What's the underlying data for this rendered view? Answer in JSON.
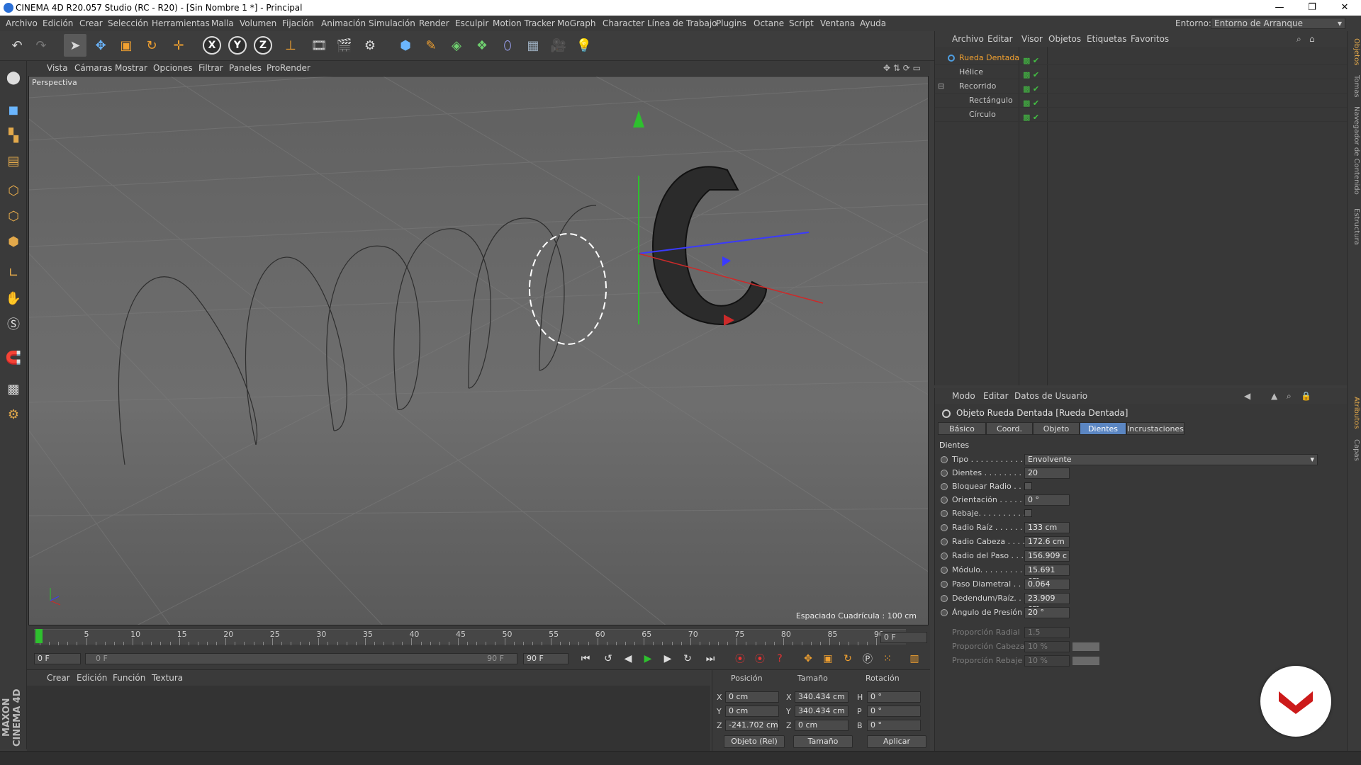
{
  "window": {
    "title": "CINEMA 4D R20.057 Studio (RC - R20) - [Sin Nombre 1 *] - Principal",
    "minimize": "—",
    "maximize": "❐",
    "close": "✕"
  },
  "menu": [
    "Archivo",
    "Edición",
    "Crear",
    "Selección",
    "Herramientas",
    "Malla",
    "Volumen",
    "Fijación",
    "Animación",
    "Simulación",
    "Render",
    "Esculpir",
    "Motion Tracker",
    "MoGraph",
    "Character",
    "Línea de Trabajo",
    "Plugins",
    "Octane",
    "Script",
    "Ventana",
    "Ayuda"
  ],
  "environment": {
    "label": "Entorno:",
    "value": "Entorno de Arranque"
  },
  "toolbar": {
    "axis_x": "X",
    "axis_y": "Y",
    "axis_z": "Z",
    "icons": [
      "undo-icon",
      "redo-icon",
      "select-arrow-icon",
      "move-icon",
      "scale-icon",
      "rotate-icon",
      "live-select-icon",
      "coordinate-system-icon",
      "render-view-icon",
      "render-picture-viewer-icon",
      "render-settings-icon",
      "cube-icon",
      "pen-icon",
      "subdivision-icon",
      "array-icon",
      "deformer-icon",
      "floor-icon",
      "camera-icon",
      "light-icon"
    ]
  },
  "viewport": {
    "menu": [
      "Vista",
      "Cámaras",
      "Mostrar",
      "Opciones",
      "Filtrar",
      "Paneles",
      "ProRender"
    ],
    "label": "Perspectiva",
    "grid_info": "Espaciado Cuadrícula : 100 cm"
  },
  "timeline": {
    "ticks": [
      "0",
      "5",
      "10",
      "15",
      "20",
      "25",
      "30",
      "35",
      "40",
      "45",
      "50",
      "55",
      "60",
      "65",
      "70",
      "75",
      "80",
      "85",
      "90"
    ],
    "frame_end_display": "0 F",
    "current_frame": "0 F",
    "range_start": "0 F",
    "range_end_label": "90 F",
    "max_frame": "90 F"
  },
  "materials": {
    "menu": [
      "Crear",
      "Edición",
      "Función",
      "Textura"
    ]
  },
  "coordinates": {
    "headers": {
      "position": "Posición",
      "size": "Tamaño",
      "rotation": "Rotación"
    },
    "rows": [
      {
        "axis": "X",
        "pos": "0 cm",
        "size_axis": "X",
        "size": "340.434 cm",
        "rot_axis": "H",
        "rot": "0 °"
      },
      {
        "axis": "Y",
        "pos": "0 cm",
        "size_axis": "Y",
        "size": "340.434 cm",
        "rot_axis": "P",
        "rot": "0 °"
      },
      {
        "axis": "Z",
        "pos": "-241.702 cm",
        "size_axis": "Z",
        "size": "0 cm",
        "rot_axis": "B",
        "rot": "0 °"
      }
    ],
    "mode": "Objeto (Rel)",
    "size_mode": "Tamaño",
    "apply": "Aplicar"
  },
  "object_manager": {
    "menu": [
      "Archivo",
      "Editar",
      "Visor",
      "Objetos",
      "Etiquetas",
      "Favoritos"
    ],
    "objects": [
      {
        "name": "Rueda Dentada",
        "selected": true
      },
      {
        "name": "Hélice",
        "selected": false
      },
      {
        "name": "Recorrido",
        "selected": false
      },
      {
        "name": "Rectángulo",
        "selected": false
      },
      {
        "name": "Círculo",
        "selected": false
      }
    ]
  },
  "attributes": {
    "menu": [
      "Modo",
      "Editar",
      "Datos de Usuario"
    ],
    "title": "Objeto Rueda Dentada [Rueda Dentada]",
    "tabs": [
      "Básico",
      "Coord.",
      "Objeto",
      "Dientes",
      "Incrustaciones"
    ],
    "active_tab": "Dientes",
    "section": "Dientes",
    "fields": [
      {
        "label": "Tipo . . . . . . . . . . . . .",
        "value": "Envolvente",
        "kind": "dropdown"
      },
      {
        "label": "Dientes . . . . . . . . . . .",
        "value": "20",
        "kind": "number"
      },
      {
        "label": "Bloquear Radio . . .",
        "value": "",
        "kind": "checkbox"
      },
      {
        "label": "Orientación . . . . . .",
        "value": "0 °",
        "kind": "number"
      },
      {
        "label": "Rebaje. . . . . . . . . . .",
        "value": "",
        "kind": "checkbox"
      },
      {
        "label": "Radio Raíz . . . . . . .",
        "value": "133 cm",
        "kind": "number"
      },
      {
        "label": "Radio Cabeza . . . . .",
        "value": "172.6 cm",
        "kind": "number"
      },
      {
        "label": "Radio del Paso . . . .",
        "value": "156.909 c",
        "kind": "number"
      },
      {
        "label": "Módulo. . . . . . . . . . .",
        "value": "15.691 cm",
        "kind": "number"
      },
      {
        "label": "Paso Diametral . . . .",
        "value": "0.064",
        "kind": "number"
      },
      {
        "label": "Dedendum/Raíz. . . .",
        "value": "23.909 cm",
        "kind": "number"
      },
      {
        "label": "Ángulo de Presión",
        "value": "20 °",
        "kind": "number"
      }
    ],
    "disabled_fields": [
      {
        "label": "Proporción Radial",
        "value": "1.5"
      },
      {
        "label": "Proporción Cabeza",
        "value": "10 %"
      },
      {
        "label": "Proporción Rebaje",
        "value": "10 %"
      }
    ]
  },
  "side_tabs": [
    "Objetos",
    "Tomas",
    "Navegador de Contenido",
    "Estructura",
    "Atributos",
    "Capas"
  ],
  "brand": {
    "maxon": "MAXON CINEMA 4D",
    "badge_color": "#cc1a1a"
  },
  "colors": {
    "accent": "#5b86c2",
    "selected_object": "#f0a030",
    "check": "#43c143"
  }
}
